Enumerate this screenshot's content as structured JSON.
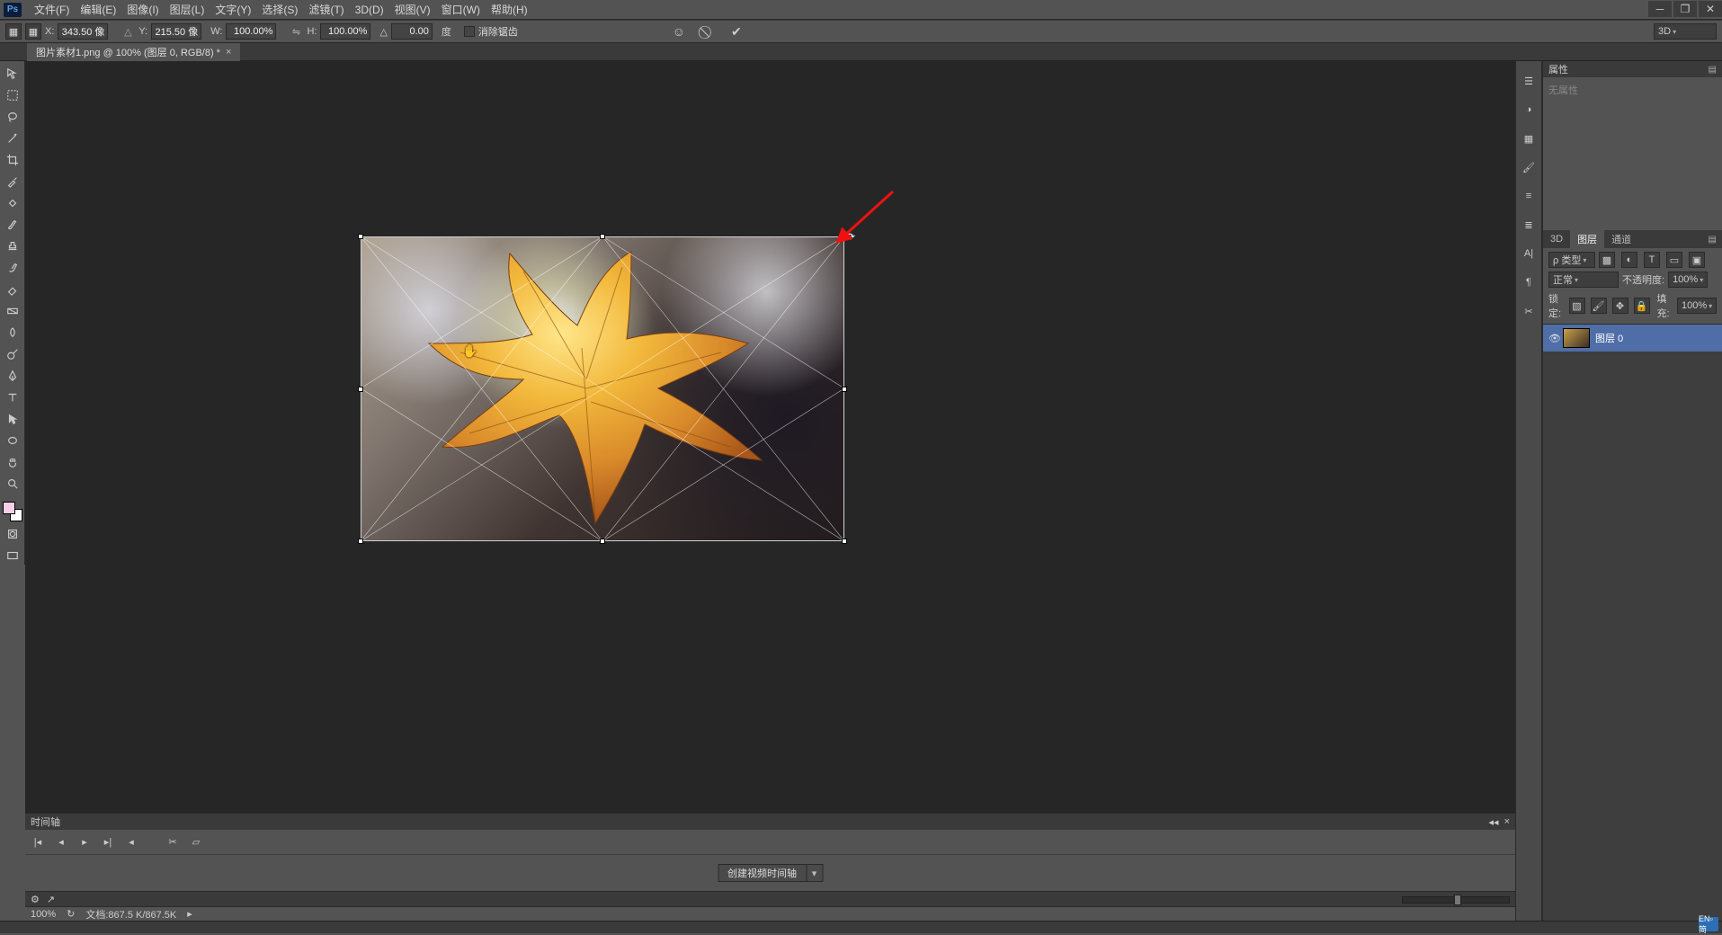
{
  "app": {
    "logo": "Ps"
  },
  "menu": {
    "file": "文件(F)",
    "edit": "编辑(E)",
    "image": "图像(I)",
    "layer": "图层(L)",
    "type": "文字(Y)",
    "select": "选择(S)",
    "filter": "滤镜(T)",
    "threeD": "3D(D)",
    "view": "视图(V)",
    "window": "窗口(W)",
    "help": "帮助(H)"
  },
  "options": {
    "x_label": "X:",
    "x_value": "343.50 像",
    "y_label": "Y:",
    "y_value": "215.50 像",
    "w_label": "W:",
    "w_value": "100.00%",
    "h_label": "H:",
    "h_value": "100.00%",
    "angle_label": "△",
    "angle_value": "0.00",
    "deg_label": "度",
    "antialias_label": "消除锯齿",
    "mode_value": "3D"
  },
  "tab": {
    "title": "图片素材1.png @ 100% (图层 0, RGB/8) *"
  },
  "timeline": {
    "title": "时间轴",
    "create_button": "创建视频时间轴"
  },
  "status": {
    "zoom": "100%",
    "docinfo": "文档:867.5 K/867.5K"
  },
  "properties": {
    "title": "属性",
    "empty": "无属性"
  },
  "layers": {
    "tabs": {
      "threeD": "3D",
      "layers": "图层",
      "channels": "通道"
    },
    "kind_label": "ρ 类型",
    "blend_value": "正常",
    "opacity_label": "不透明度:",
    "opacity_value": "100%",
    "lock_label": "锁定:",
    "fill_label": "填充:",
    "fill_value": "100%",
    "layer_name": "图层 0"
  },
  "tray": {
    "ime": "EN▫简"
  }
}
